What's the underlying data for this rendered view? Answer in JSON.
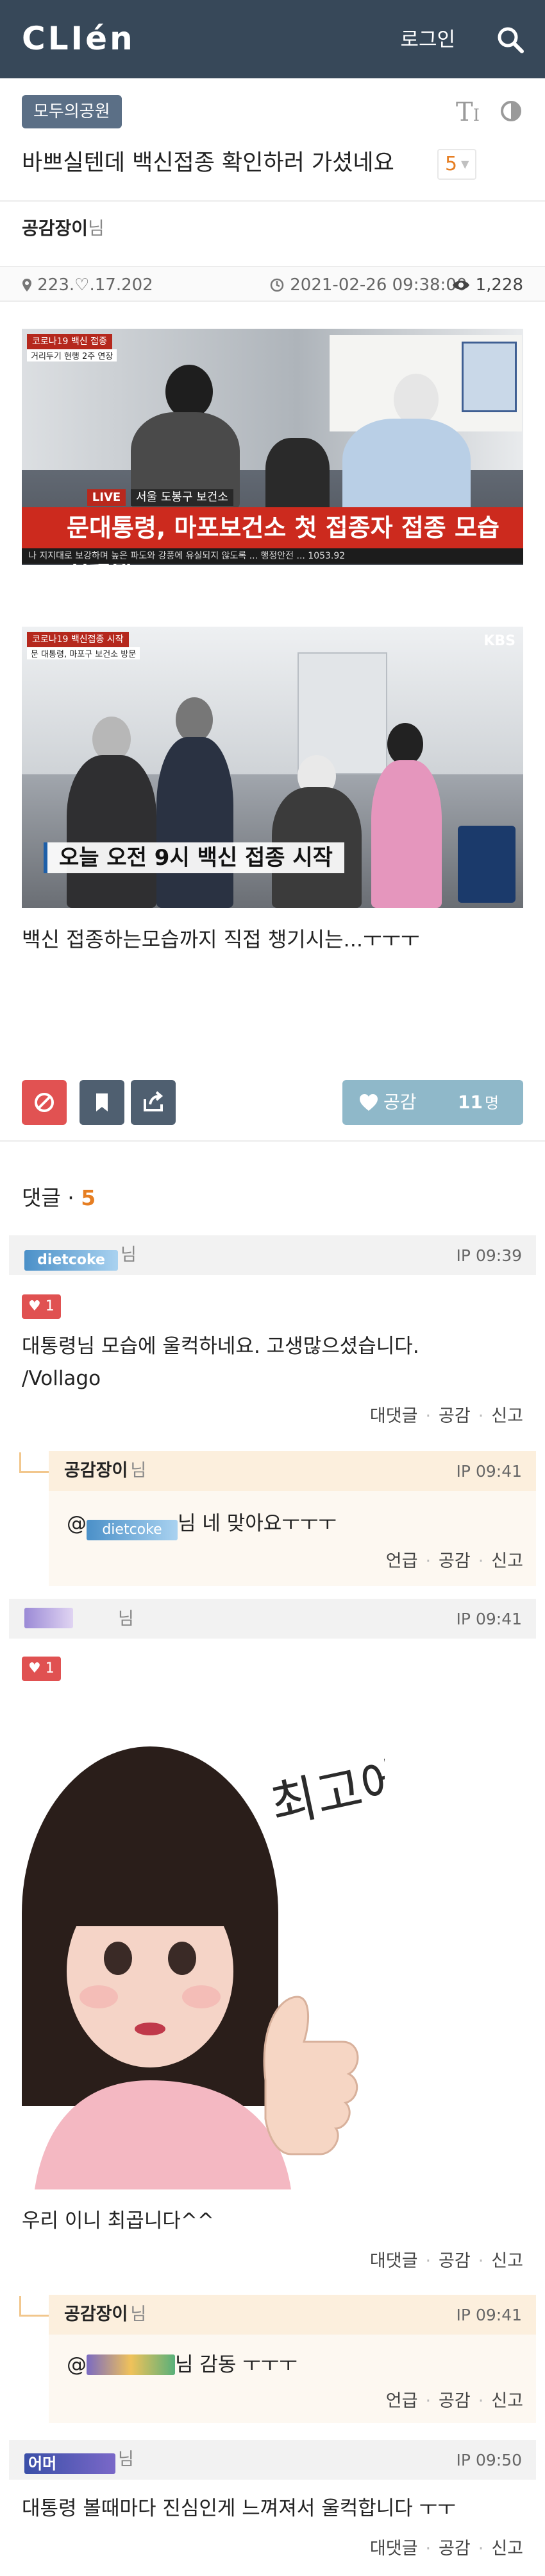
{
  "header": {
    "logo": "CLIén",
    "login": "로그인"
  },
  "post": {
    "board": "모두의공원",
    "font_icon": "T",
    "title": "바쁘실텐데 백신접종 확인하러 가셨네요",
    "title_comment_count": "5",
    "author": "공감장이",
    "author_suffix": "님",
    "ip": "223.♡.17.202",
    "datetime": "2021-02-26 09:38:00",
    "views": "1,228",
    "image1": {
      "tag": "코로나19 백신 접종",
      "sub_tag": "거리두기 현행 2주 연장",
      "location": "서울 도봉구 보건소",
      "live": "LIVE",
      "headline": "문대통령, 마포보건소 첫 접종자 접종 모습 지켜봐",
      "ticker": "나 지지대로 보강하며 높은 파도와 강풍에 유실되지 않도록 ... 행정안전 ... 1053.92"
    },
    "image2": {
      "broadcaster": "KBS",
      "tag": "코로나19 백신접종 시작",
      "sub_tag": "문 대통령, 마포구 보건소 방문",
      "caption": "오늘 오전 9시 백신 접종 시작"
    },
    "body": "백신 접종하는모습까지 직접 챙기시는...ㅜㅜㅜ",
    "like_label": "공감",
    "like_count": "11",
    "like_unit": "명"
  },
  "comments_header": {
    "label": "댓글",
    "count": "5"
  },
  "comments": [
    {
      "nick": "dietcoke",
      "suffix": "님",
      "ip": "IP",
      "time": "09:39",
      "likes": "1",
      "text_line1": "대통령님 모습에 울컥하네요. 고생많으셨습니다.",
      "text_line2": "/Vollago",
      "actions": [
        "대댓글",
        "공감",
        "신고"
      ]
    },
    {
      "nick": "공감장이",
      "suffix": "님",
      "ip": "IP",
      "time": "09:41",
      "mention_prefix": "@",
      "mention_nick": "dietcoke",
      "text": "님 네 맞아요ㅜㅜㅜ",
      "actions": [
        "언급",
        "공감",
        "신고"
      ]
    },
    {
      "nick": "",
      "suffix": "님",
      "ip": "IP",
      "time": "09:41",
      "likes": "1",
      "sticker_text": "최고에요",
      "text": "우리 이니 최곱니다^^",
      "actions": [
        "대댓글",
        "공감",
        "신고"
      ]
    },
    {
      "nick": "공감장이",
      "suffix": "님",
      "ip": "IP",
      "time": "09:41",
      "mention_prefix": "@",
      "text": "님 감동 ㅜㅜㅜ",
      "actions": [
        "언급",
        "공감",
        "신고"
      ]
    },
    {
      "nick": "어머",
      "suffix": "님",
      "ip": "IP",
      "time": "09:50",
      "text": "대통령 볼때마다 진심인게 느껴져서 울컥합니다 ㅜㅜ",
      "actions": [
        "대댓글",
        "공감",
        "신고"
      ]
    }
  ],
  "colors": {
    "header": "#374859",
    "accent_orange": "#e67e22",
    "like_button": "#8fb8c9",
    "heart_red": "#e05151"
  },
  "icons": [
    "search-icon",
    "font-size-icon",
    "contrast-icon",
    "location-icon",
    "clock-icon",
    "eye-icon",
    "block-icon",
    "bookmark-icon",
    "share-icon",
    "heart-icon"
  ]
}
